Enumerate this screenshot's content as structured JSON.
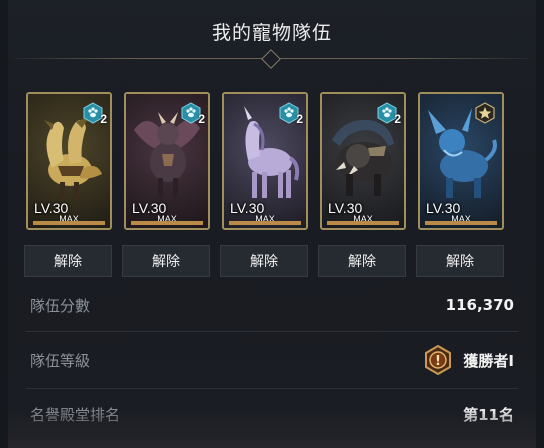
{
  "title": "我的寵物隊伍",
  "pets": [
    {
      "level": "LV.30",
      "max": "MAX",
      "badge": "2",
      "badge_icon": "paw-icon",
      "level_fill": 1.0,
      "bg": "#3b3624"
    },
    {
      "level": "LV.30",
      "max": "MAX",
      "badge": "2",
      "badge_icon": "paw-icon",
      "level_fill": 1.0,
      "bg": "#3a2d33"
    },
    {
      "level": "LV.30",
      "max": "MAX",
      "badge": "2",
      "badge_icon": "paw-icon",
      "level_fill": 1.0,
      "bg": "#3a3748"
    },
    {
      "level": "LV.30",
      "max": "MAX",
      "badge": "2",
      "badge_icon": "paw-icon",
      "level_fill": 1.0,
      "bg": "#2e2f33"
    },
    {
      "level": "LV.30",
      "max": "MAX",
      "badge": "",
      "badge_icon": "star-icon",
      "level_fill": 1.0,
      "bg": "#22344a"
    }
  ],
  "buttons": [
    "解除",
    "解除",
    "解除",
    "解除",
    "解除"
  ],
  "stats": {
    "score_label": "隊伍分數",
    "score_value": "116,370",
    "grade_label": "隊伍等級",
    "grade_value": "獲勝者I",
    "rank_label": "名譽殿堂排名",
    "rank_value": "第11名"
  },
  "colors": {
    "frame": "#a08f5c",
    "bar": "#b98a48",
    "badge": "#2a8fa6"
  }
}
